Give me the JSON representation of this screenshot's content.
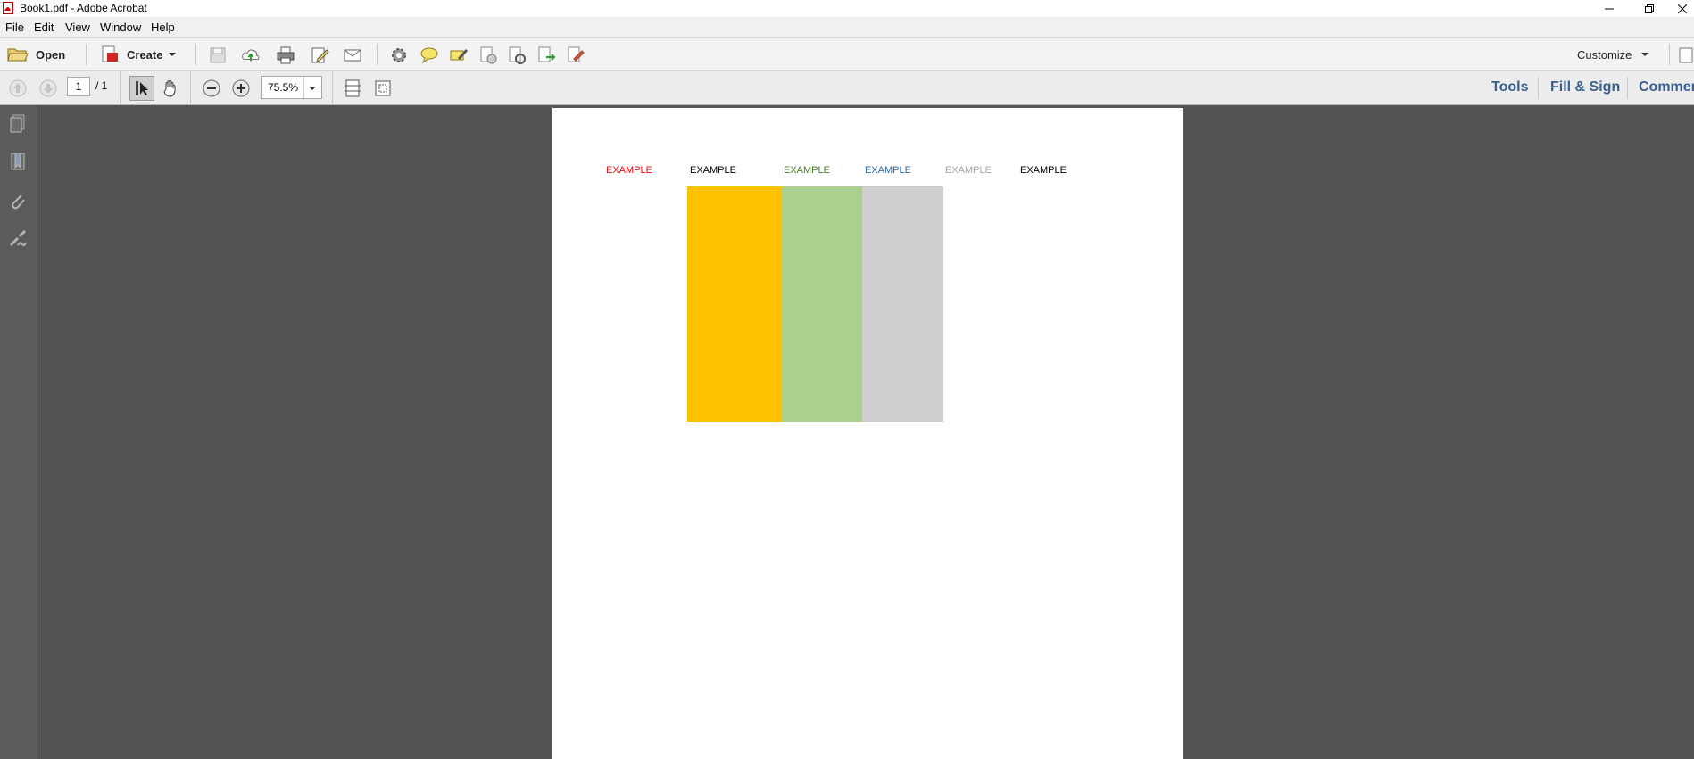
{
  "window": {
    "title": "Book1.pdf - Adobe Acrobat",
    "controls": [
      "minimize",
      "restore",
      "close"
    ]
  },
  "menu": {
    "items": [
      {
        "label": "File"
      },
      {
        "label": "Edit"
      },
      {
        "label": "View"
      },
      {
        "label": "Window"
      },
      {
        "label": "Help"
      }
    ]
  },
  "toolbar": {
    "open_label": "Open",
    "create_label": "Create",
    "customize_label": "Customize",
    "icons": [
      "save-icon",
      "upload-cloud-icon",
      "print-icon",
      "edit-icon",
      "mail-icon",
      "gear-icon",
      "comment-icon",
      "highlight-icon",
      "attach-icon",
      "stamp-icon",
      "export-icon",
      "sign-icon"
    ]
  },
  "navigation": {
    "page_current": "1",
    "page_total": "/ 1",
    "zoom": "75.5%"
  },
  "panes": {
    "tools": "Tools",
    "fill_sign": "Fill & Sign",
    "comment": "Commen"
  },
  "sidebar": {
    "icons": [
      "pages-icon",
      "bookmark-icon",
      "attachment-icon",
      "signature-icon"
    ]
  },
  "document": {
    "labels": [
      {
        "text": "EXAMPLE",
        "color": "#e8090f"
      },
      {
        "text": "EXAMPLE",
        "color": "#000000"
      },
      {
        "text": "EXAMPLE",
        "color": "#4a7c1f"
      },
      {
        "text": "EXAMPLE",
        "color": "#2e6aa8"
      },
      {
        "text": "EXAMPLE",
        "color": "#a6a6a6"
      },
      {
        "text": "EXAMPLE",
        "color": "#000000"
      }
    ],
    "bar_colors": [
      "#ffc000",
      "#a9d08e",
      "#d0cece"
    ]
  }
}
